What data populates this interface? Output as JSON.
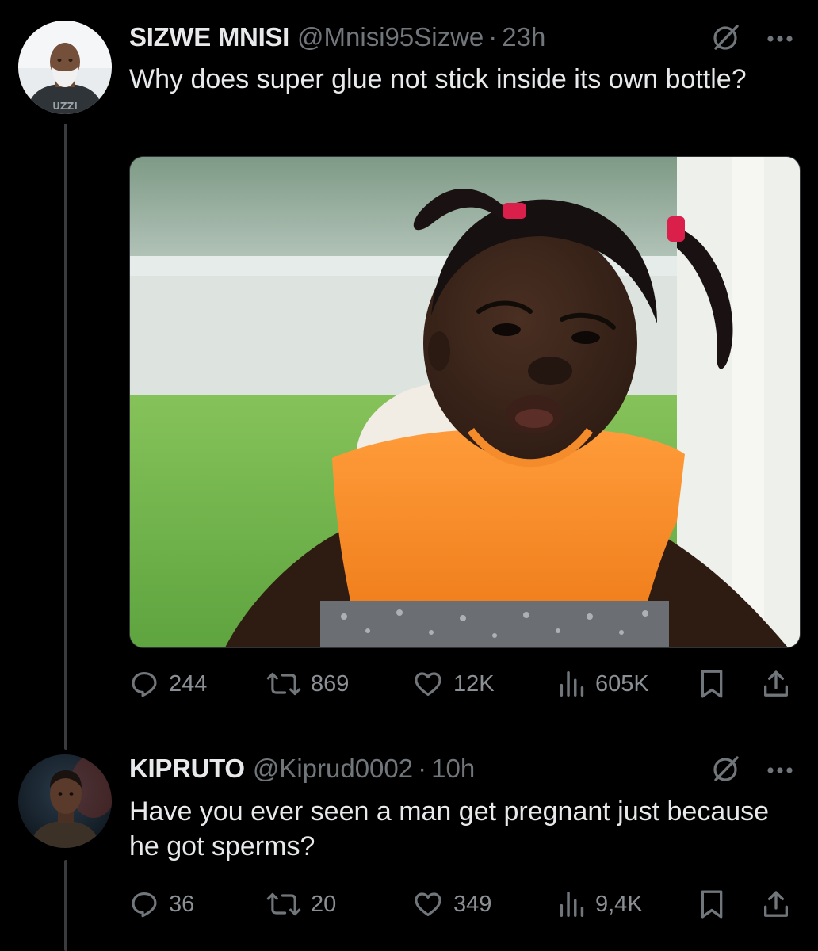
{
  "tweets": [
    {
      "display_name": "SIZWE MNISI",
      "handle": "@Mnisi95Sizwe",
      "separator": "·",
      "time": "23h",
      "text": "Why does super glue not stick inside its own bottle?",
      "avatar_shirt_text": "UZZI",
      "stats": {
        "replies": "244",
        "reposts": "869",
        "likes": "12K",
        "views": "605K"
      }
    },
    {
      "display_name": "KIPRUTO",
      "handle": "@Kiprud0002",
      "separator": "·",
      "time": "10h",
      "text": "Have you ever seen a man get pregnant just because he got sperms?",
      "stats": {
        "replies": "36",
        "reposts": "20",
        "likes": "349",
        "views": "9,4K"
      }
    }
  ],
  "icons": {
    "header": [
      "grok-icon",
      "more-icon"
    ],
    "actions": [
      "reply-icon",
      "repost-icon",
      "like-icon",
      "views-icon",
      "bookmark-icon",
      "share-icon"
    ]
  },
  "colors": {
    "background": "#000000",
    "primary_text": "#e7e9ea",
    "secondary_text": "#71767b",
    "thread_line": "#3a3b3c"
  }
}
